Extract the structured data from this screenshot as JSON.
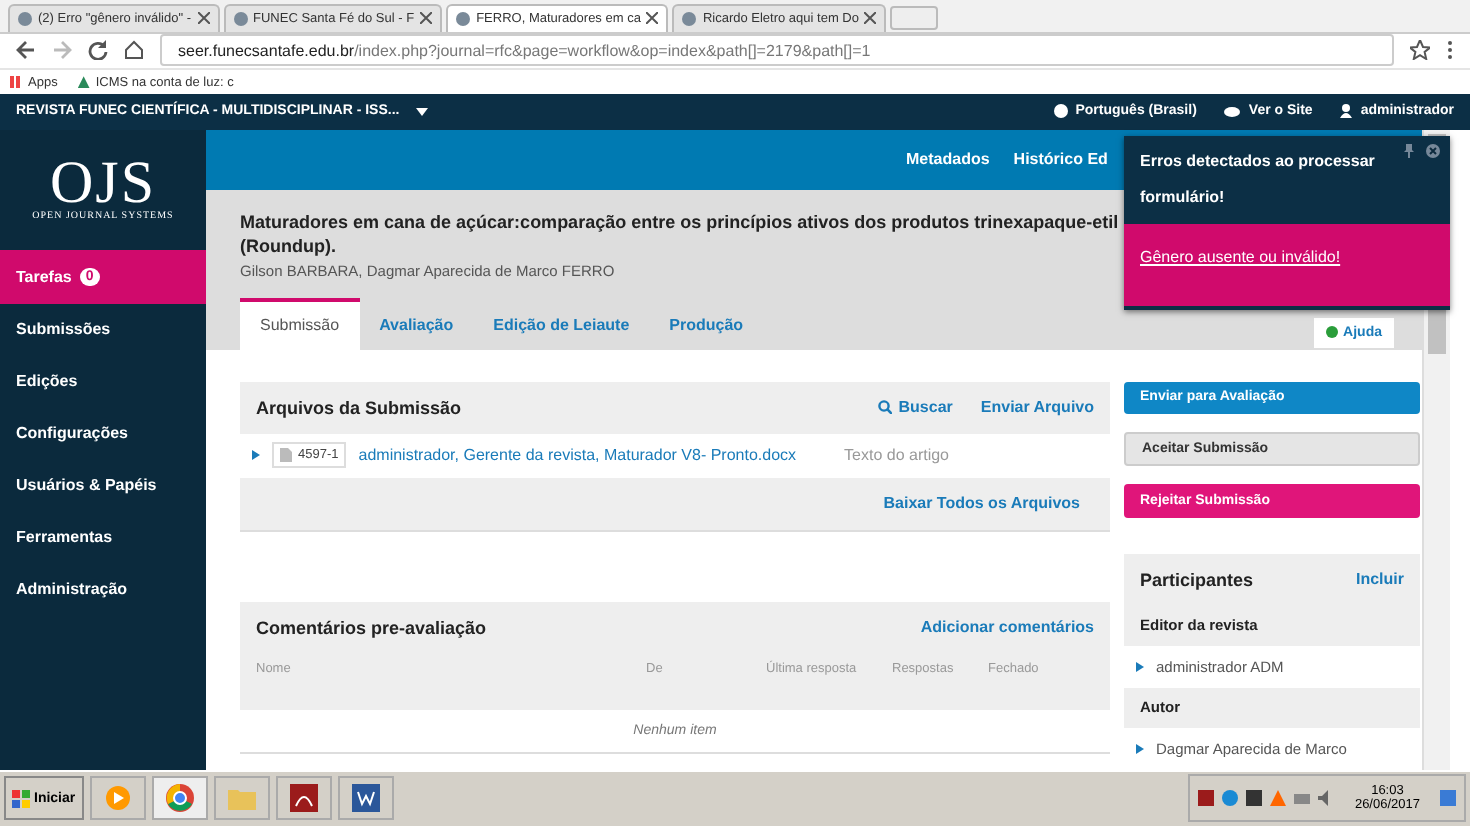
{
  "browser": {
    "tabs": [
      {
        "title": "(2) Erro \"gênero inválido\" -",
        "selected": false
      },
      {
        "title": "FUNEC Santa Fé do Sul - F",
        "selected": false
      },
      {
        "title": "FERRO, Maturadores em ca",
        "selected": true
      },
      {
        "title": "Ricardo Eletro aqui tem Do",
        "selected": false
      }
    ],
    "url": {
      "host": "seer.funecsantafe.edu.br",
      "path": "/index.php?journal=rfc&page=workflow&op=index&path[]=2179&path[]=1"
    },
    "bookmarks": [
      "Apps",
      "ICMS na conta de luz: c"
    ]
  },
  "header": {
    "journal": "REVISTA FUNEC CIENTÍFICA - MULTIDISCIPLINAR - ISS...",
    "language": "Português (Brasil)",
    "view_site": "Ver o Site",
    "user": "administrador"
  },
  "sidebar": {
    "logo": "OJS",
    "logo_sub": "OPEN JOURNAL SYSTEMS",
    "items": [
      {
        "label": "Tarefas",
        "badge": "0",
        "selected": true
      },
      {
        "label": "Submissões",
        "selected": false
      },
      {
        "label": "Edições",
        "selected": false
      },
      {
        "label": "Configurações",
        "selected": false
      },
      {
        "label": "Usuários & Papéis",
        "selected": false
      },
      {
        "label": "Ferramentas",
        "selected": false
      },
      {
        "label": "Administração",
        "selected": false
      }
    ]
  },
  "top_nav": [
    "Metadados",
    "Histórico Ed"
  ],
  "notification": {
    "title": "Erros detectados ao processar formulário!",
    "message": "Gênero ausente ou inválido!"
  },
  "submission": {
    "title": "Maturadores em cana de açúcar:comparação entre os princípios ativos dos produtos trinexapaque-etil (Roundup).",
    "authors": "Gilson BARBARA, Dagmar Aparecida de Marco FERRO"
  },
  "tabs": [
    {
      "label": "Submissão",
      "selected": true
    },
    {
      "label": "Avaliação",
      "selected": false
    },
    {
      "label": "Edição de Leiaute",
      "selected": false
    },
    {
      "label": "Produção",
      "selected": false
    }
  ],
  "help": "Ajuda",
  "files_panel": {
    "title": "Arquivos da Submissão",
    "search": "Buscar",
    "upload": "Enviar Arquivo",
    "rows": [
      {
        "id": "4597-1",
        "name": "administrador, Gerente da revista, Maturador V8- Pronto.docx",
        "type": "Texto do artigo"
      }
    ],
    "footer_link": "Baixar Todos os Arquivos"
  },
  "comments_panel": {
    "title": "Comentários pre-avaliação",
    "action": "Adicionar comentários",
    "columns": [
      "Nome",
      "De",
      "Última resposta",
      "Respostas",
      "Fechado"
    ],
    "empty": "Nenhum item"
  },
  "actions": [
    {
      "label": "Enviar para Avaliação",
      "kind": "primary"
    },
    {
      "label": "Aceitar Submissão",
      "kind": "default"
    },
    {
      "label": "Rejeitar Submissão",
      "kind": "danger"
    }
  ],
  "participants": {
    "title": "Participantes",
    "action": "Incluir",
    "groups": [
      {
        "title": "Editor da revista",
        "members": [
          "administrador ADM"
        ]
      },
      {
        "title": "Autor",
        "members": [
          "Dagmar Aparecida de Marco"
        ]
      }
    ]
  },
  "taskbar": {
    "start": "Iniciar",
    "time": "16:03",
    "date": "26/06/2017"
  }
}
